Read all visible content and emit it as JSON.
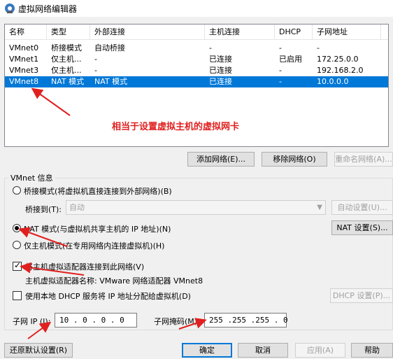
{
  "window": {
    "title": "虚拟网络编辑器"
  },
  "table": {
    "columns": [
      "名称",
      "类型",
      "外部连接",
      "主机连接",
      "DHCP",
      "子网地址"
    ],
    "rows": [
      [
        "VMnet0",
        "桥接模式",
        "自动桥接",
        "-",
        "-",
        "-"
      ],
      [
        "VMnet1",
        "仅主机...",
        "-",
        "已连接",
        "已启用",
        "172.25.0.0"
      ],
      [
        "VMnet3",
        "仅主机...",
        "-",
        "已连接",
        "-",
        "192.168.2.0"
      ],
      [
        "VMnet8",
        "NAT 模式",
        "NAT 模式",
        "已连接",
        "-",
        "10.0.0.0"
      ]
    ],
    "selected_index": 3
  },
  "annotation": "相当于设置虚拟主机的虚拟网卡",
  "buttons": {
    "add_network": "添加网络(E)...",
    "remove_network": "移除网络(O)",
    "rename_network": "重命名网络(A)...",
    "auto_settings": "自动设置(U)...",
    "nat_settings": "NAT 设置(S)...",
    "dhcp_settings": "DHCP 设置(P)...",
    "restore_defaults": "还原默认设置(R)",
    "ok": "确定",
    "cancel": "取消",
    "apply": "应用(A)",
    "help": "帮助"
  },
  "vmnet_info": {
    "group_title": "VMnet 信息",
    "bridge_mode": "桥接模式(将虚拟机直接连接到外部网络)(B)",
    "bridge_to_label": "桥接到(T):",
    "bridge_to_value": "自动",
    "nat_mode": "NAT 模式(与虚拟机共享主机的 IP 地址)(N)",
    "host_only_mode": "仅主机模式(在专用网络内连接虚拟机)(H)",
    "selected_mode": "nat",
    "connect_adapter": "将主机虚拟适配器连接到此网络(V)",
    "connect_adapter_checked": true,
    "adapter_name": "主机虚拟适配器名称: VMware 网络适配器 VMnet8",
    "use_dhcp": "使用本地 DHCP 服务将 IP 地址分配给虚拟机(D)",
    "use_dhcp_checked": false,
    "subnet_ip_label": "子网 IP (I):",
    "subnet_ip_value": "10 . 0 . 0 . 0",
    "subnet_mask_label": "子网掩码(M):",
    "subnet_mask_value": "255 .255 .255 . 0"
  },
  "colors": {
    "selection": "#0078d7",
    "annotation": "#e0201f"
  }
}
